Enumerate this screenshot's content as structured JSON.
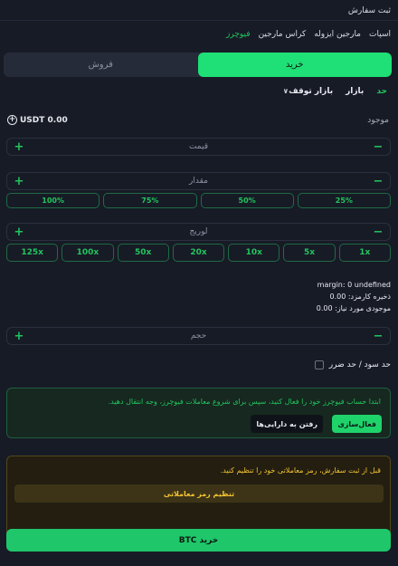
{
  "header": {
    "title": "ثبت سفارش"
  },
  "mode_tabs": [
    {
      "label": "اسپات",
      "active": false
    },
    {
      "label": "مارجین ایزوله",
      "active": false
    },
    {
      "label": "کراس مارجین",
      "active": false
    },
    {
      "label": "فیوچرز",
      "active": true
    }
  ],
  "side": {
    "buy_label": "خرید",
    "sell_label": "فروش",
    "selected": "buy"
  },
  "order_types": {
    "limit": "حد",
    "market": "بازار",
    "stop_market": "بازار توقف",
    "selected": "limit"
  },
  "balance": {
    "label": "موجود",
    "value": "USDT 0.00"
  },
  "price_field": {
    "placeholder": "قیمت"
  },
  "amount_field": {
    "placeholder": "مقدار"
  },
  "amount_percents": [
    "25%",
    "50%",
    "75%",
    "100%"
  ],
  "leverage": {
    "placeholder": "لوریج",
    "options": [
      "1x",
      "5x",
      "10x",
      "20x",
      "50x",
      "100x",
      "125x"
    ]
  },
  "info": {
    "margin": "margin: 0 undefined",
    "fee_label": "ذخیره کارمزد:",
    "fee_value": "0.00",
    "required_label": "موجودی مورد نیاز:",
    "required_value": "0.00"
  },
  "volume_field": {
    "placeholder": "حجم"
  },
  "tp_sl": {
    "label": "حد سود / حد ضرر",
    "checked": false
  },
  "futures_alert": {
    "message": "ابتدا حساب فیوچرز خود را فعال کنید، سپس برای شروع معاملات فیوچرز، وجه انتقال دهید.",
    "activate_label": "فعال‌سازی",
    "assets_label": "رفتن به دارایی‌ها"
  },
  "password_alert": {
    "message": "قبل از ثبت سفارش، رمز معاملاتی خود را تنظیم کنید.",
    "button_label": "تنظیم رمز معاملاتی"
  },
  "submit": {
    "label": "خرید BTC"
  },
  "colors": {
    "background": "#171b26",
    "accent": "#22c55e",
    "warning": "#f4c430"
  }
}
